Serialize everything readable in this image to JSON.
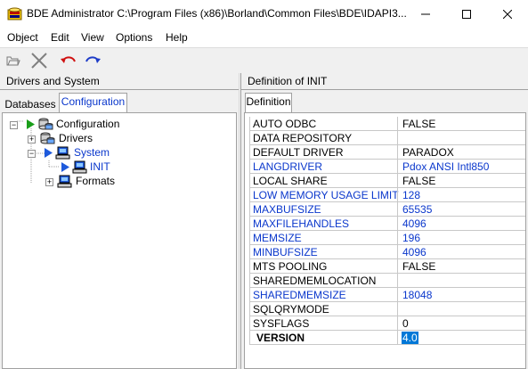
{
  "window": {
    "title": "BDE Administrator  C:\\Program Files (x86)\\Borland\\Common Files\\BDE\\IDAPI3...",
    "controls": [
      "minimize",
      "maximize",
      "close"
    ]
  },
  "menu": [
    "Object",
    "Edit",
    "View",
    "Options",
    "Help"
  ],
  "toolbar": {
    "icons": [
      "open-icon",
      "delete-icon",
      "undo-icon",
      "redo-icon"
    ]
  },
  "left_pane": {
    "header": "Drivers and System",
    "tabs": [
      {
        "label": "Databases",
        "active": false
      },
      {
        "label": "Configuration",
        "active": true
      }
    ],
    "tree": [
      {
        "label": "Configuration",
        "expander": "−"
      },
      {
        "label": "Drivers",
        "expander": "+"
      },
      {
        "label": "System",
        "expander": "−"
      },
      {
        "label": "INIT",
        "expander": ""
      },
      {
        "label": "Formats",
        "expander": "+"
      }
    ]
  },
  "right_pane": {
    "header": "Definition of INIT",
    "tabs": [
      {
        "label": "Definition",
        "active": true
      }
    ],
    "rows": [
      {
        "name": "AUTO ODBC",
        "value": "FALSE",
        "highlight": false
      },
      {
        "name": "DATA REPOSITORY",
        "value": "",
        "highlight": false
      },
      {
        "name": "DEFAULT DRIVER",
        "value": "PARADOX",
        "highlight": false
      },
      {
        "name": "LANGDRIVER",
        "value": "Pdox ANSI Intl850",
        "highlight": true
      },
      {
        "name": "LOCAL SHARE",
        "value": "FALSE",
        "highlight": false
      },
      {
        "name": "LOW MEMORY USAGE LIMIT",
        "value": "128",
        "highlight": true
      },
      {
        "name": "MAXBUFSIZE",
        "value": "65535",
        "highlight": true
      },
      {
        "name": "MAXFILEHANDLES",
        "value": "4096",
        "highlight": true
      },
      {
        "name": "MEMSIZE",
        "value": "196",
        "highlight": true
      },
      {
        "name": "MINBUFSIZE",
        "value": "4096",
        "highlight": true
      },
      {
        "name": "MTS POOLING",
        "value": "FALSE",
        "highlight": false
      },
      {
        "name": "SHAREDMEMLOCATION",
        "value": "",
        "highlight": false
      },
      {
        "name": "SHAREDMEMSIZE",
        "value": "18048",
        "highlight": true
      },
      {
        "name": "SQLQRYMODE",
        "value": "",
        "highlight": false
      },
      {
        "name": "SYSFLAGS",
        "value": "0",
        "highlight": false
      },
      {
        "name": "VERSION",
        "value": "4.0",
        "highlight": false,
        "bold": true,
        "selected": true
      }
    ]
  },
  "colors": {
    "accent_blue": "#0a37cc",
    "selection": "#0078d7",
    "play_green": "#1a9e1a",
    "play_blue": "#1e5adc"
  }
}
